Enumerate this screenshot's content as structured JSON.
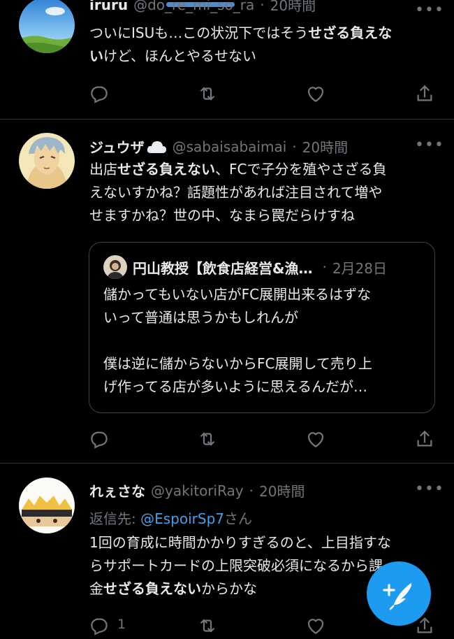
{
  "tweets": [
    {
      "display_name": "iruru",
      "handle": "@do_re_mi_so_ra",
      "separator": "·",
      "time": "20時間",
      "lines": [
        [
          {
            "t": "ついにISUも…この状況下ではそう"
          },
          {
            "t": "せざる負えな",
            "b": true
          }
        ],
        [
          {
            "t": "い",
            "b": true
          },
          {
            "t": "けど、ほんとやるせない"
          }
        ]
      ]
    },
    {
      "display_name": "ジュウザ",
      "name_emoji": "cloud-emoji",
      "handle": "@sabaisabaimai",
      "separator": "·",
      "time": "20時間",
      "lines": [
        [
          {
            "t": "出店"
          },
          {
            "t": "せざる負えない",
            "b": true
          },
          {
            "t": "、FCで子分を殖やさざる負"
          }
        ],
        [
          {
            "t": "えないすかね？話題性があれば注目されて増や"
          }
        ],
        [
          {
            "t": "せますかね？世の中、なまら罠だらけすね"
          }
        ]
      ],
      "quote": {
        "name": "円山教授【飲食店経営&漁…",
        "separator": "·",
        "date": "2月28日",
        "lines": [
          "儲かってもいない店がFC展開出来るはずな",
          "いって普通は思うかもしれんが",
          "",
          "僕は逆に儲からないからFC展開して売り上",
          "げ作ってる店が多いように思えるんだが…"
        ]
      }
    },
    {
      "display_name": "れぇさな",
      "handle": "@yakitoriRay",
      "separator": "·",
      "time": "20時間",
      "reply_prefix": "返信先: ",
      "reply_mention": "@EspoirSp7",
      "reply_suffix": "さん",
      "lines": [
        [
          {
            "t": "1回の育成に時間かかりすぎるのと、上目指すな"
          }
        ],
        [
          {
            "t": "らサポートカードの上限突破必須になるから課"
          }
        ],
        [
          {
            "t": "金"
          },
          {
            "t": "せざる負えない",
            "b": true
          },
          {
            "t": "からかな"
          }
        ]
      ],
      "reply_count": "1"
    }
  ],
  "icons": {
    "more": "more-icon",
    "reply": "reply-icon",
    "retweet": "retweet-icon",
    "like": "like-icon",
    "share": "share-icon",
    "compose": "compose-tweet-icon"
  },
  "colors": {
    "background": "#000000",
    "text": "#e7e9ea",
    "secondary": "#71767b",
    "accent": "#1d9bf0",
    "mention": "#4a9ee8",
    "divider": "#2f3336"
  }
}
